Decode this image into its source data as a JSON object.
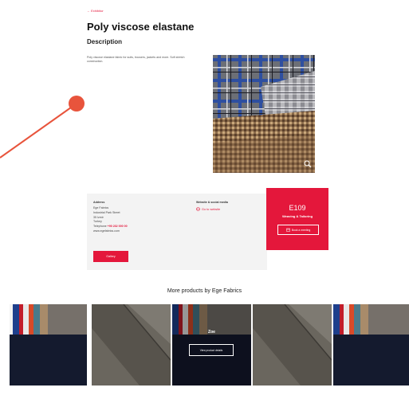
{
  "header": {
    "back_link": "← Exhibitor",
    "title": "Poly viscose elastane"
  },
  "description": {
    "heading": "Description",
    "text": "Poly viscose elastane fabric for suits, trousers, jackets and more. Soft stretch construction."
  },
  "hero": {
    "image_icon": "zoom-icon"
  },
  "exhibitor": {
    "label": "Address",
    "lines": [
      "Ege Fabrics",
      "Industrial Park Street",
      "35 Izmir",
      "Turkey",
      "Telephone",
      "www.egefabrics.com"
    ],
    "telephone_value": "+90 232 000 00",
    "gallery_button": "Gallery"
  },
  "links": {
    "label": "Website & social media",
    "website": "Go to website"
  },
  "stand": {
    "number": "E109",
    "category": "Weaving & Tailoring",
    "meet_button": "Book a meeting"
  },
  "more_products": {
    "heading": "More products by Ege Fabrics",
    "hover_name": "Zoe",
    "hover_button": "View product details"
  },
  "colors": {
    "accent": "#e4173b",
    "annotation": "#e8543c",
    "panel": "#f3f3f3"
  }
}
